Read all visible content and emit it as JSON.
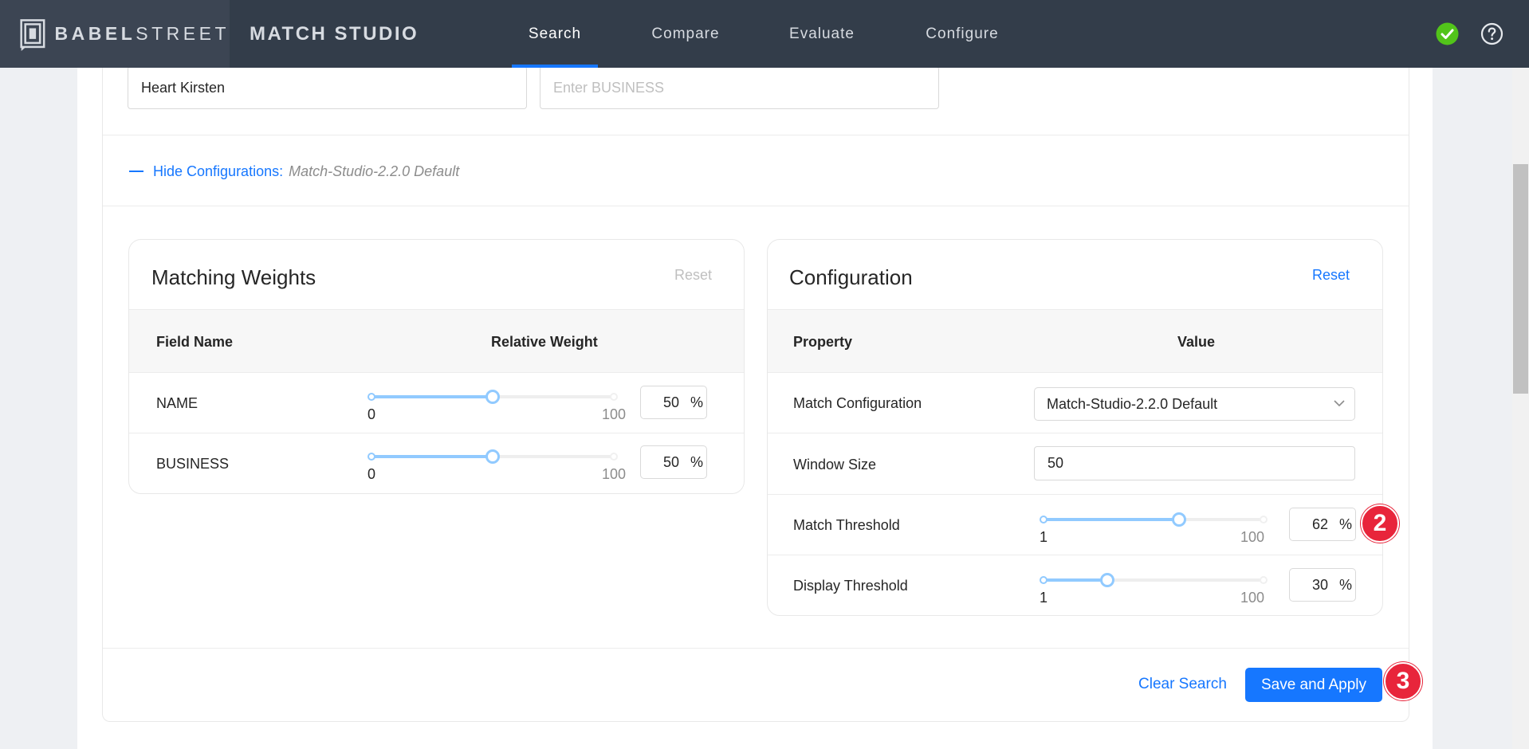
{
  "brand": {
    "name_bold": "BABEL",
    "name_light": "STREET"
  },
  "app": {
    "title": "MATCH STUDIO"
  },
  "nav": {
    "items": [
      {
        "label": "Search",
        "active": true
      },
      {
        "label": "Compare",
        "active": false
      },
      {
        "label": "Evaluate",
        "active": false
      },
      {
        "label": "Configure",
        "active": false
      }
    ]
  },
  "icons": {
    "status": "check-circle-icon",
    "help": "question-circle-icon"
  },
  "colors": {
    "topbar": "#333d4a",
    "accent": "#1677ff",
    "status_ok": "#52c41a",
    "badge": "#e8253b",
    "slider_fill": "#91caff"
  },
  "search": {
    "name_value": "Heart Kirsten",
    "business_placeholder": "Enter BUSINESS"
  },
  "config_toggle": {
    "label": "Hide Configurations:",
    "config_name": "Match-Studio-2.2.0 Default"
  },
  "matching_weights": {
    "title": "Matching Weights",
    "reset_label": "Reset",
    "col_field": "Field Name",
    "col_weight": "Relative Weight",
    "rows": [
      {
        "field": "NAME",
        "min": "0",
        "max": "100",
        "value": "50",
        "unit": "%"
      },
      {
        "field": "BUSINESS",
        "min": "0",
        "max": "100",
        "value": "50",
        "unit": "%"
      }
    ]
  },
  "configuration": {
    "title": "Configuration",
    "reset_label": "Reset",
    "col_property": "Property",
    "col_value": "Value",
    "match_configuration": {
      "label": "Match Configuration",
      "selected": "Match-Studio-2.2.0 Default"
    },
    "window_size": {
      "label": "Window Size",
      "value": "50"
    },
    "match_threshold": {
      "label": "Match Threshold",
      "min": "1",
      "max": "100",
      "value": "62",
      "unit": "%"
    },
    "display_threshold": {
      "label": "Display Threshold",
      "min": "1",
      "max": "100",
      "value": "30",
      "unit": "%"
    }
  },
  "footer": {
    "clear_label": "Clear Search",
    "save_label": "Save and Apply"
  },
  "badges": {
    "threshold_step": "2",
    "save_step": "3"
  }
}
